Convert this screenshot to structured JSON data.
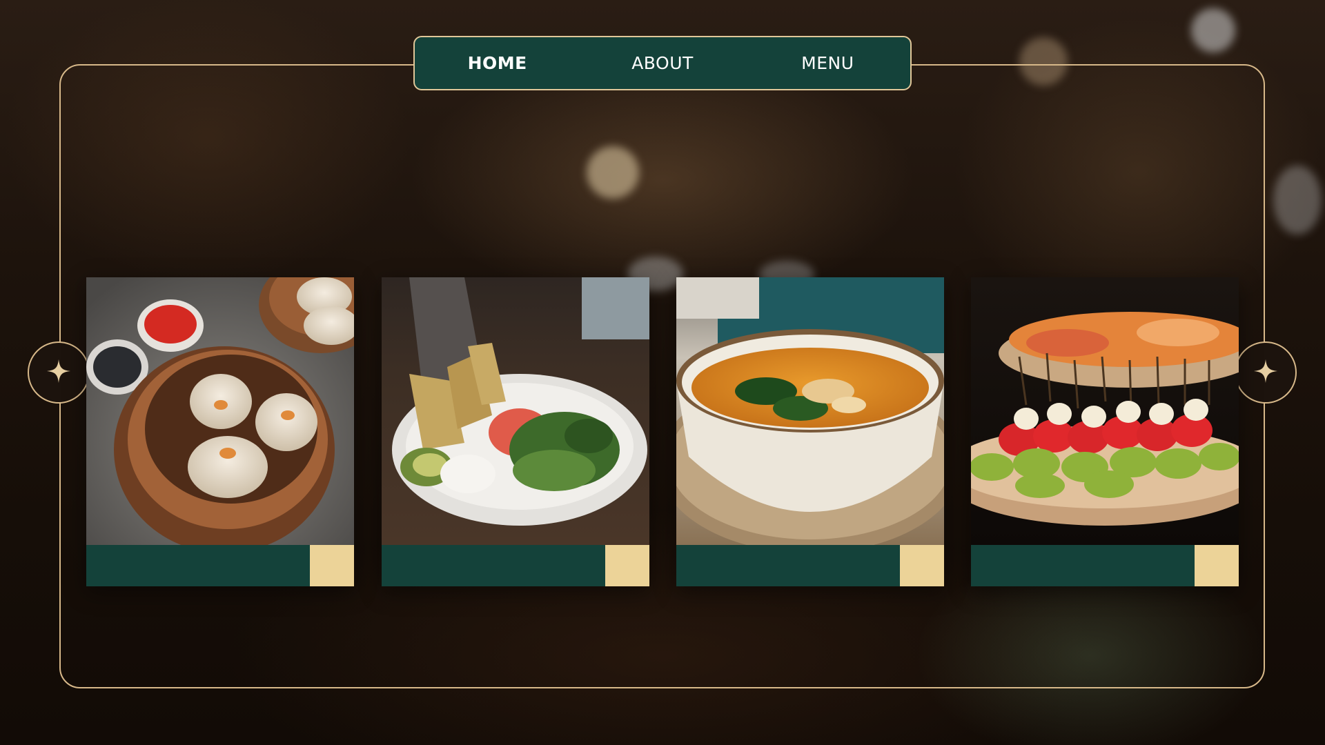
{
  "nav": {
    "items": [
      {
        "label": "HOME",
        "active": true
      },
      {
        "label": "ABOUT",
        "active": false
      },
      {
        "label": "MENU",
        "active": false
      }
    ]
  },
  "carousel": {
    "prev_icon": "sparkle-icon",
    "next_icon": "sparkle-icon",
    "cards": [
      {
        "image": "dim-sum-steamer-photo"
      },
      {
        "image": "salad-plate-photo"
      },
      {
        "image": "pumpkin-soup-photo"
      },
      {
        "image": "appetizer-platter-photo"
      }
    ]
  },
  "colors": {
    "accent_green": "#14423a",
    "accent_gold": "#ecd398",
    "frame_gold": "#d8b98a"
  }
}
